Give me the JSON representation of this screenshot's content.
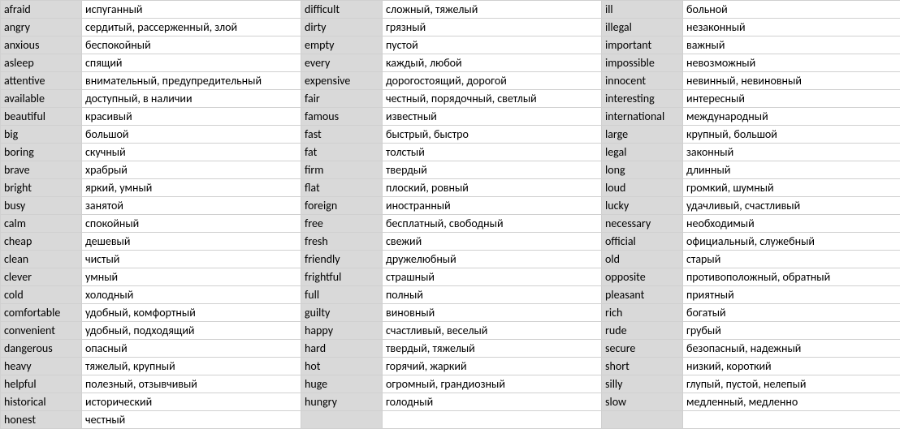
{
  "rows": [
    {
      "e1": "afraid",
      "r1": "испуганный",
      "e2": "difficult",
      "r2": "сложный, тяжелый",
      "e3": "ill",
      "r3": "больной"
    },
    {
      "e1": "angry",
      "r1": "сердитый, рассерженный, злой",
      "e2": "dirty",
      "r2": "грязный",
      "e3": "illegal",
      "r3": "незаконный"
    },
    {
      "e1": "anxious",
      "r1": "беспокойный",
      "e2": "empty",
      "r2": "пустой",
      "e3": "important",
      "r3": "важный"
    },
    {
      "e1": "asleep",
      "r1": "спящий",
      "e2": "every",
      "r2": "каждый, любой",
      "e3": "impossible",
      "r3": "невозможный"
    },
    {
      "e1": "attentive",
      "r1": "внимательный, предупредительный",
      "e2": "expensive",
      "r2": "дорогостоящий, дорогой",
      "e3": "innocent",
      "r3": "невинный, невиновный"
    },
    {
      "e1": "available",
      "r1": "доступный, в наличии",
      "e2": "fair",
      "r2": "честный, порядочный, светлый",
      "e3": "interesting",
      "r3": "интересный"
    },
    {
      "e1": "beautiful",
      "r1": "красивый",
      "e2": "famous",
      "r2": "известный",
      "e3": "international",
      "r3": "международный"
    },
    {
      "e1": "big",
      "r1": "большой",
      "e2": "fast",
      "r2": "быстрый, быстро",
      "e3": "large",
      "r3": "крупный, большой"
    },
    {
      "e1": "boring",
      "r1": "скучный",
      "e2": "fat",
      "r2": "толстый",
      "e3": "legal",
      "r3": "законный"
    },
    {
      "e1": "brave",
      "r1": "храбрый",
      "e2": "firm",
      "r2": "твердый",
      "e3": "long",
      "r3": "длинный"
    },
    {
      "e1": "bright",
      "r1": "яркий, умный",
      "e2": "flat",
      "r2": "плоский, ровный",
      "e3": "loud",
      "r3": "громкий, шумный"
    },
    {
      "e1": "busy",
      "r1": "занятой",
      "e2": "foreign",
      "r2": "иностранный",
      "e3": "lucky",
      "r3": "удачливый, счастливый"
    },
    {
      "e1": "calm",
      "r1": "спокойный",
      "e2": "free",
      "r2": "бесплатный, свободный",
      "e3": "necessary",
      "r3": "необходимый"
    },
    {
      "e1": "cheap",
      "r1": "дешевый",
      "e2": "fresh",
      "r2": "свежий",
      "e3": "official",
      "r3": "официальный, служебный"
    },
    {
      "e1": "clean",
      "r1": "чистый",
      "e2": "friendly",
      "r2": "дружелюбный",
      "e3": "old",
      "r3": "старый"
    },
    {
      "e1": "clever",
      "r1": "умный",
      "e2": "frightful",
      "r2": "страшный",
      "e3": "opposite",
      "r3": "противоположный, обратный"
    },
    {
      "e1": "cold",
      "r1": "холодный",
      "e2": "full",
      "r2": "полный",
      "e3": "pleasant",
      "r3": "приятный"
    },
    {
      "e1": "comfortable",
      "r1": "удобный, комфортный",
      "e2": "guilty",
      "r2": "виновный",
      "e3": "rich",
      "r3": "богатый"
    },
    {
      "e1": "convenient",
      "r1": "удобный, подходящий",
      "e2": "happy",
      "r2": "счастливый, веселый",
      "e3": "rude",
      "r3": "грубый"
    },
    {
      "e1": "dangerous",
      "r1": "опасный",
      "e2": "hard",
      "r2": "твердый, тяжелый",
      "e3": "secure",
      "r3": "безопасный, надежный"
    },
    {
      "e1": "heavy",
      "r1": "тяжелый, крупный",
      "e2": "hot",
      "r2": "горячий, жаркий",
      "e3": "short",
      "r3": "низкий, короткий"
    },
    {
      "e1": "helpful",
      "r1": "полезный, отзывчивый",
      "e2": "huge",
      "r2": "огромный, грандиозный",
      "e3": "silly",
      "r3": "глупый, пустой, нелепый"
    },
    {
      "e1": "historical",
      "r1": "исторический",
      "e2": "hungry",
      "r2": "голодный",
      "e3": "slow",
      "r3": "медленный, медленно"
    },
    {
      "e1": "honest",
      "r1": "честный",
      "e2": "",
      "r2": "",
      "e3": "",
      "r3": ""
    }
  ]
}
